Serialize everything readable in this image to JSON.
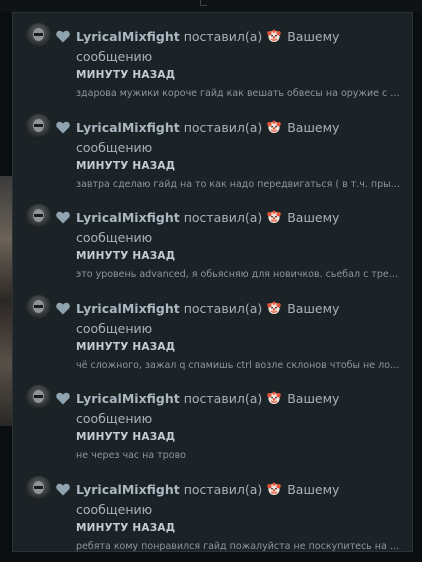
{
  "notifications": [
    {
      "username": "LyricalMixfight",
      "action_before": "поставил(а)",
      "reaction_icon": "clown-face-icon",
      "action_after": "Вашему сообщению",
      "time": "МИНУТУ НАЗАД",
      "preview": "здарова мужики короче гайд как вешать обвесы на оружие с пониманием"
    },
    {
      "username": "LyricalMixfight",
      "action_before": "поставил(а)",
      "reaction_icon": "clown-face-icon",
      "action_after": "Вашему сообщению",
      "time": "МИНУТУ НАЗАД",
      "preview": "завтра сделаю гайд на то как надо передвигаться ( в т.ч. прыгать )"
    },
    {
      "username": "LyricalMixfight",
      "action_before": "поставил(а)",
      "reaction_icon": "clown-face-icon",
      "action_after": "Вашему сообщению",
      "time": "МИНУТУ НАЗАД",
      "preview": "это уровень advanced, я обьясняю для новичков. сьебал с треда"
    },
    {
      "username": "LyricalMixfight",
      "action_before": "поставил(а)",
      "reaction_icon": "clown-face-icon",
      "action_after": "Вашему сообщению",
      "time": "МИНУТУ НАЗАД",
      "preview": "чё сложного, зажал q спамишь ctrl возле склонов чтобы не ложиться"
    },
    {
      "username": "LyricalMixfight",
      "action_before": "поставил(а)",
      "reaction_icon": "clown-face-icon",
      "action_after": "Вашему сообщению",
      "time": "МИНУТУ НАЗАД",
      "preview": "не через час на трово"
    },
    {
      "username": "LyricalMixfight",
      "action_before": "поставил(а)",
      "reaction_icon": "clown-face-icon",
      "action_after": "Вашему сообщению",
      "time": "МИНУТУ НАЗАД",
      "preview": "ребята кому понравился гайд пожалуйста не поскупитесь на лайк"
    }
  ],
  "colors": {
    "panel_bg": "#1c2327",
    "username": "#aab7c1",
    "text": "#a9b2b7",
    "time": "#c3ccd1",
    "preview": "#8d979c",
    "heart": "#8fa3b1"
  }
}
